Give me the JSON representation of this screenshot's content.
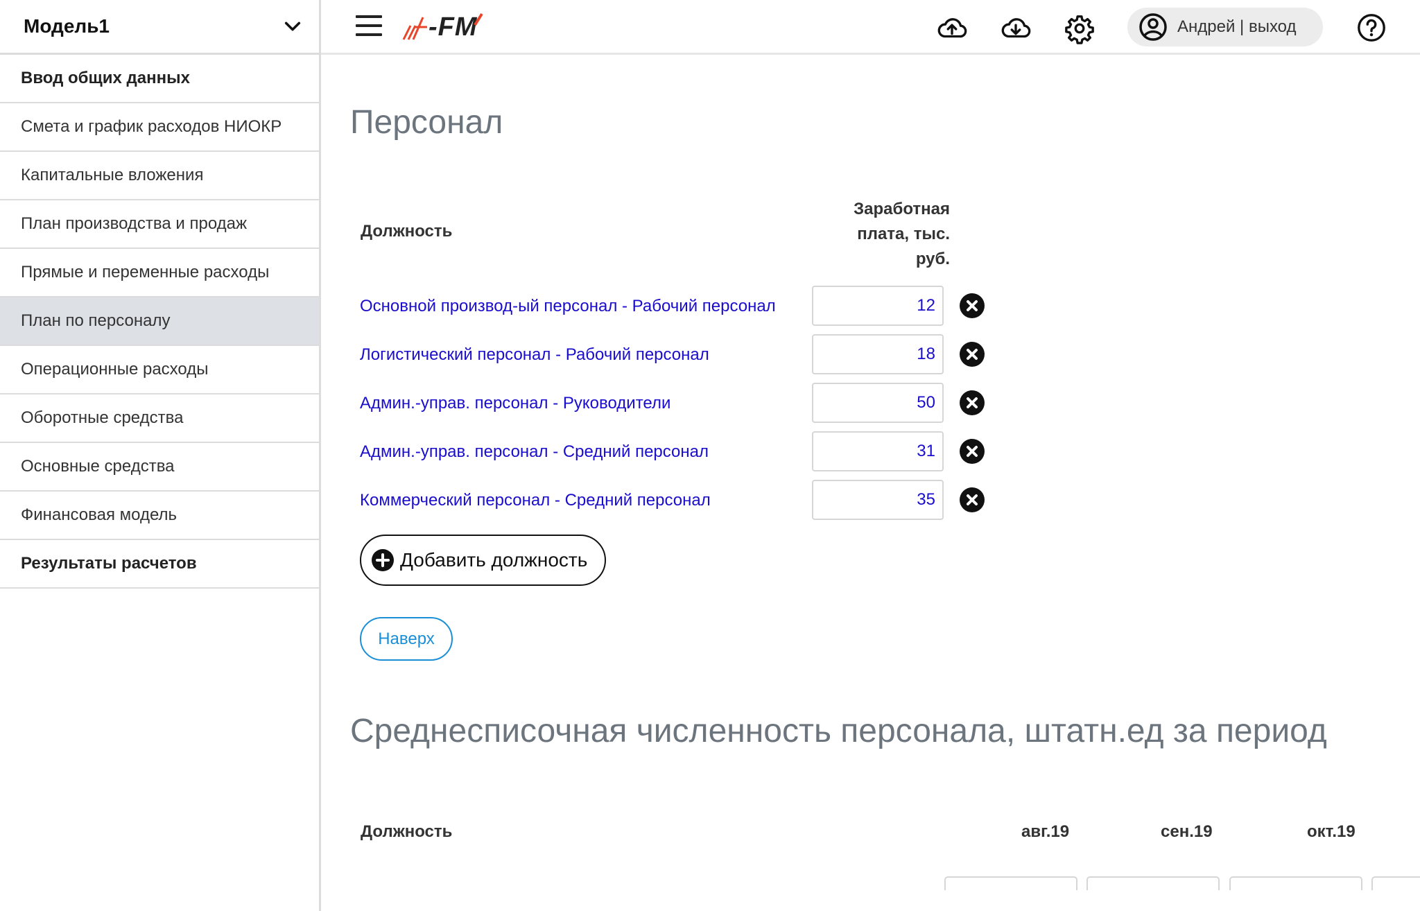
{
  "model": {
    "name": "Модель1"
  },
  "sidebar": {
    "items": [
      {
        "label": "Ввод общих данных"
      },
      {
        "label": "Смета и график расходов НИОКР"
      },
      {
        "label": "Капитальные вложения"
      },
      {
        "label": "План производства и продаж"
      },
      {
        "label": "Прямые и переменные расходы"
      },
      {
        "label": "План по персоналу"
      },
      {
        "label": "Операционные расходы"
      },
      {
        "label": "Оборотные средства"
      },
      {
        "label": "Основные средства"
      },
      {
        "label": "Финансовая модель"
      },
      {
        "label": "Результаты расчетов"
      }
    ],
    "active": "План по персоналу"
  },
  "header": {
    "logo_text": "-FM",
    "user_label": "Андрей | выход"
  },
  "personnel": {
    "title": "Персонал",
    "col_position": "Должность",
    "col_salary": "Заработная плата, тыс. руб.",
    "rows": [
      {
        "position": "Основной производ-ый персонал - Рабочий персонал",
        "salary": "12"
      },
      {
        "position": "Логистический персонал - Рабочий персонал",
        "salary": "18"
      },
      {
        "position": "Админ.-управ. персонал - Руководители",
        "salary": "50"
      },
      {
        "position": "Админ.-управ. персонал - Средний персонал",
        "salary": "31"
      },
      {
        "position": "Коммерческий персонал - Средний персонал",
        "salary": "35"
      }
    ],
    "add_label": "Добавить должность",
    "top_label": "Наверх"
  },
  "headcount": {
    "title": "Среднесписочная численность персонала, штатн.ед за период",
    "col_position": "Должность",
    "months": [
      "авг.19",
      "сен.19",
      "окт.19"
    ]
  }
}
